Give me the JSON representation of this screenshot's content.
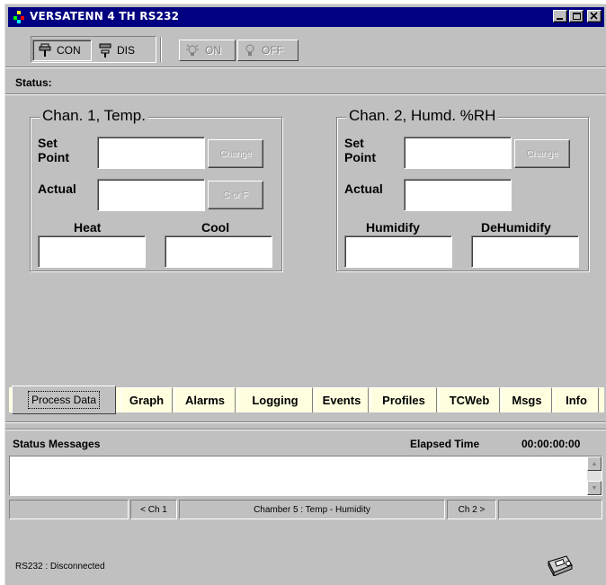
{
  "window": {
    "title": "VERSATENN 4 TH RS232"
  },
  "toolbar": {
    "con_label": "CON",
    "dis_label": "DIS",
    "on_label": "ON",
    "off_label": "OFF"
  },
  "status": {
    "label": "Status:"
  },
  "chan1": {
    "title": "Chan. 1, Temp.",
    "set_point_label": "Set\nPoint",
    "actual_label": "Actual",
    "change_label": "Change",
    "units_label": "C or F",
    "left_label": "Heat",
    "right_label": "Cool",
    "set_point_value": "",
    "actual_value": "",
    "left_value": "",
    "right_value": ""
  },
  "chan2": {
    "title": "Chan. 2, Humd. %RH",
    "set_point_label": "Set\nPoint",
    "actual_label": "Actual",
    "change_label": "Change",
    "left_label": "Humidify",
    "right_label": "DeHumidify",
    "set_point_value": "",
    "actual_value": "",
    "left_value": "",
    "right_value": ""
  },
  "tabs": [
    {
      "label": "Process Data",
      "active": true
    },
    {
      "label": "Graph"
    },
    {
      "label": "Alarms"
    },
    {
      "label": "Logging"
    },
    {
      "label": "Events"
    },
    {
      "label": "Profiles"
    },
    {
      "label": "TCWeb"
    },
    {
      "label": "Msgs"
    },
    {
      "label": "Info"
    }
  ],
  "messages": {
    "header": "Status Messages",
    "elapsed_label": "Elapsed Time",
    "elapsed_value": "00:00:00:00",
    "content": ""
  },
  "nav": {
    "prev": "< Ch 1",
    "chamber": "Chamber 5 : Temp - Humidity",
    "next": "Ch 2 >"
  },
  "footer": {
    "connection_status": "RS232 : Disconnected"
  },
  "colors": {
    "titlebar": "#000080",
    "face": "#c0c0c0",
    "tabstrip": "#ffffe0"
  },
  "icons": [
    "plug-icon",
    "bulb-icon",
    "printer-icon"
  ]
}
